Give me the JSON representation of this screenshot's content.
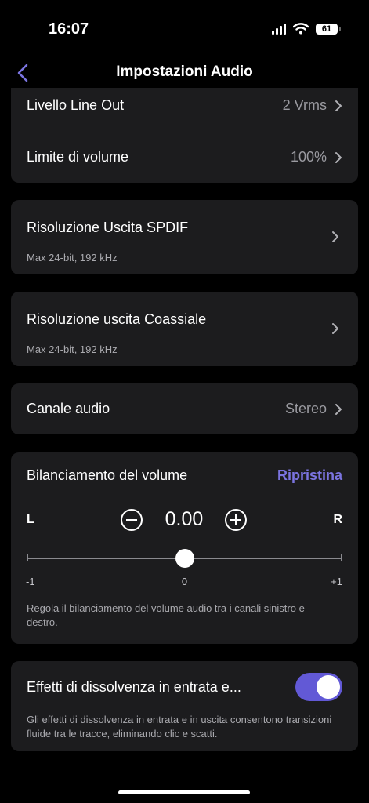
{
  "status": {
    "time": "16:07",
    "battery": "61"
  },
  "nav": {
    "title": "Impostazioni Audio"
  },
  "line_out": {
    "label": "Livello Line Out",
    "value": "2 Vrms"
  },
  "volume_limit": {
    "label": "Limite di volume",
    "value": "100%"
  },
  "spdif": {
    "label": "Risoluzione Uscita SPDIF",
    "sub": "Max 24-bit, 192 kHz"
  },
  "coax": {
    "label": "Risoluzione uscita Coassiale",
    "sub": "Max 24-bit, 192 kHz"
  },
  "channel": {
    "label": "Canale audio",
    "value": "Stereo"
  },
  "balance": {
    "title": "Bilanciamento del volume",
    "reset": "Ripristina",
    "left": "L",
    "right": "R",
    "value": "0.00",
    "min_label": "-1",
    "mid_label": "0",
    "max_label": "+1",
    "slider_min": -1,
    "slider_max": 1,
    "slider_value": 0,
    "description": "Regola il bilanciamento del volume audio tra i canali sinistro e destro."
  },
  "fade": {
    "label": "Effetti di dissolvenza in entrata e...",
    "enabled": true,
    "description": "Gli effetti di dissolvenza in entrata e in uscita consentono transizioni fluide tra le tracce, eliminando clic e scatti."
  },
  "colors": {
    "accent": "#6259d6",
    "reset": "#7b74e0",
    "card": "#1c1c1e",
    "background": "#000000"
  }
}
